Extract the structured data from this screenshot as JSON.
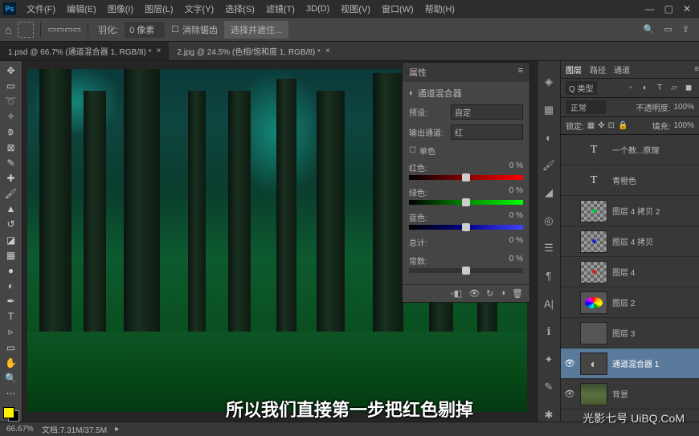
{
  "menubar": {
    "items": [
      "文件(F)",
      "编辑(E)",
      "图像(I)",
      "图层(L)",
      "文字(Y)",
      "选择(S)",
      "滤镜(T)",
      "3D(D)",
      "视图(V)",
      "窗口(W)",
      "帮助(H)"
    ]
  },
  "optbar": {
    "feather_label": "羽化:",
    "feather_value": "0 像素",
    "antialias_label": "消除锯齿",
    "style_label": "选择并遮住..."
  },
  "tabs": [
    {
      "label": "1.psd @ 66.7% (通道混合器 1, RGB/8) *",
      "active": true
    },
    {
      "label": "2.jpg @ 24.5% (色相/饱和度 1, RGB/8) *",
      "active": false
    }
  ],
  "properties": {
    "title": "属性",
    "panel_name": "通道混合器",
    "preset_label": "预设:",
    "preset_value": "自定",
    "output_label": "输出通道:",
    "output_value": "红",
    "mono_label": "单色",
    "channels": [
      {
        "name": "红色:",
        "value": "0",
        "unit": "%",
        "class": "red",
        "pos": 50
      },
      {
        "name": "绿色:",
        "value": "0",
        "unit": "%",
        "class": "green",
        "pos": 50
      },
      {
        "name": "蓝色:",
        "value": "0",
        "unit": "%",
        "class": "blue",
        "pos": 50
      }
    ],
    "total": {
      "name": "总计:",
      "value": "0",
      "unit": "%"
    },
    "constant": {
      "name": "常数:",
      "value": "0",
      "unit": "%",
      "pos": 50
    }
  },
  "layers_panel": {
    "tabs": [
      "图层",
      "路径",
      "通道"
    ],
    "kind_label": "Q 类型",
    "blend_mode": "正常",
    "opacity_label": "不透明度:",
    "opacity_value": "100%",
    "lock_label": "锁定:",
    "fill_label": "填充:",
    "fill_value": "100%",
    "layers": [
      {
        "type": "text",
        "name": "一个教...原理",
        "vis": false
      },
      {
        "type": "text",
        "name": "青橙色",
        "vis": false
      },
      {
        "type": "dot",
        "name": "图层 4 拷贝 2",
        "color": "#00c840",
        "vis": false
      },
      {
        "type": "dot",
        "name": "图层 4 拷贝",
        "color": "#2020d0",
        "vis": false
      },
      {
        "type": "dot",
        "name": "图层 4",
        "color": "#d02020",
        "vis": false
      },
      {
        "type": "rings",
        "name": "图层 2",
        "vis": false
      },
      {
        "type": "solid",
        "name": "图层 3",
        "vis": false
      },
      {
        "type": "adj",
        "name": "通道混合器 1",
        "vis": true,
        "selected": true
      },
      {
        "type": "forest",
        "name": "背景",
        "vis": true
      }
    ]
  },
  "subtitle": "所以我们直接第一步把红色剔掉",
  "watermark": "光影七号 UiBQ.CoM",
  "status": {
    "zoom": "66.67%",
    "docsize": "文档:7.31M/37.5M"
  }
}
